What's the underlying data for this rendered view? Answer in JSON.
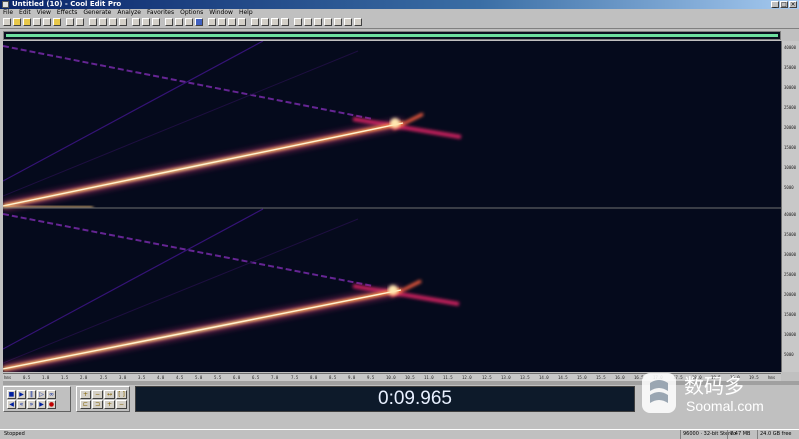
{
  "window": {
    "title": "Untitled (10) - Cool Edit Pro",
    "buttons": [
      "_",
      "□",
      "×"
    ]
  },
  "menu": [
    "File",
    "Edit",
    "View",
    "Effects",
    "Generate",
    "Analyze",
    "Favorites",
    "Options",
    "Window",
    "Help"
  ],
  "time_display": "0:09.965",
  "ruler": {
    "y_ticks": [
      "40000",
      "35000",
      "30000",
      "25000",
      "20000",
      "15000",
      "10000",
      "5000",
      "40000",
      "35000",
      "30000",
      "25000",
      "20000",
      "15000",
      "10000",
      "5000"
    ]
  },
  "timeline": {
    "ticks": [
      "hms",
      "0.5",
      "1.0",
      "1.5",
      "2.0",
      "2.5",
      "3.0",
      "3.5",
      "4.0",
      "4.5",
      "5.0",
      "5.5",
      "6.0",
      "6.5",
      "7.0",
      "7.5",
      "8.0",
      "8.5",
      "9.0",
      "9.5",
      "10.0",
      "10.5",
      "11.0",
      "11.5",
      "12.0",
      "12.5",
      "13.0",
      "13.5",
      "14.0",
      "14.5",
      "15.0",
      "15.5",
      "16.0",
      "16.5",
      "17.0",
      "17.5",
      "18.0",
      "18.5",
      "19.0",
      "19.5",
      "hms"
    ]
  },
  "status": {
    "state": "Stopped",
    "format": "96000 · 32-bit Stereo",
    "size": "7.47 MB",
    "free": "24.0 GB free"
  },
  "watermark": {
    "cn": "数码多",
    "en": "Soomal.com"
  },
  "colors": {
    "spectrum_bg": "#050a1c",
    "accent": "#6de0a0"
  }
}
